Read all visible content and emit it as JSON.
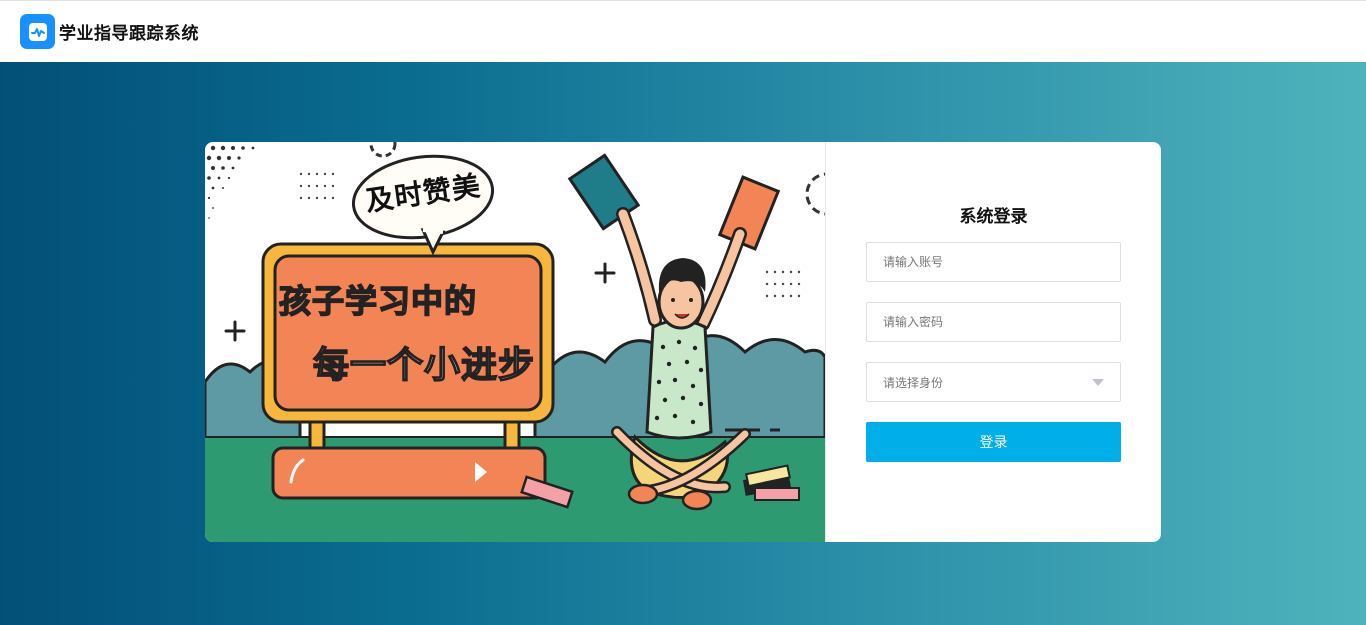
{
  "app": {
    "title": "学业指导跟踪系统",
    "logo_icon": "activity-chart-icon",
    "brand_color": "#1890ff"
  },
  "banner": {
    "speech_text": "及时赞美",
    "board_line1": "孩子学习中的",
    "board_line2": "每一个小进步"
  },
  "login": {
    "title": "系统登录",
    "account_placeholder": "请输入账号",
    "password_placeholder": "请输入密码",
    "role_select_placeholder": "请选择身份",
    "submit_label": "登录",
    "accent_color": "#00aee8"
  }
}
